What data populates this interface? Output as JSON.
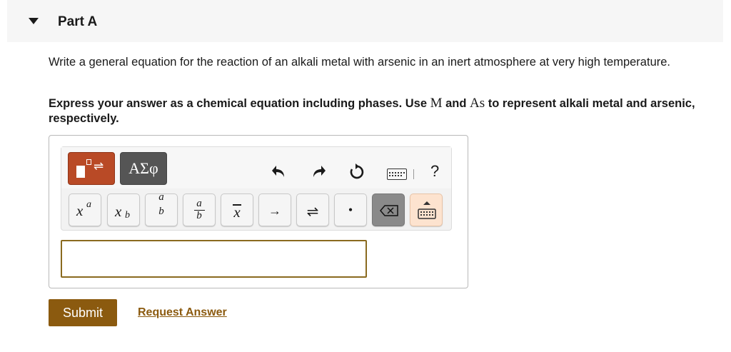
{
  "part": {
    "title": "Part A"
  },
  "question": {
    "text": "Write a general equation for the reaction of an alkali metal with arsenic in an inert atmosphere at very high temperature."
  },
  "instruction": {
    "part1": "Express your answer as a chemical equation including phases. Use ",
    "m_symbol": "M",
    "part2": " and ",
    "as_symbol": "As",
    "part3": " to represent alkali metal and arsenic, respectively."
  },
  "toolbar": {
    "greek_label": "ΑΣφ",
    "help_label": "?",
    "keys": {
      "superscript": {
        "base": "x",
        "sup": "a"
      },
      "subscript": {
        "base": "x",
        "sub": "b"
      },
      "stacked": {
        "top": "a",
        "bottom": "b"
      },
      "fraction": {
        "num": "a",
        "den": "b"
      },
      "overline": "x",
      "arrow": "→",
      "equilibrium": "⇌",
      "dot": "•"
    }
  },
  "actions": {
    "submit_label": "Submit",
    "request_label": "Request Answer"
  },
  "colors": {
    "template_button": "#b94a26",
    "submit_button": "#8b5a0f",
    "link": "#8b5a0f",
    "input_border": "#8a6a1f"
  }
}
